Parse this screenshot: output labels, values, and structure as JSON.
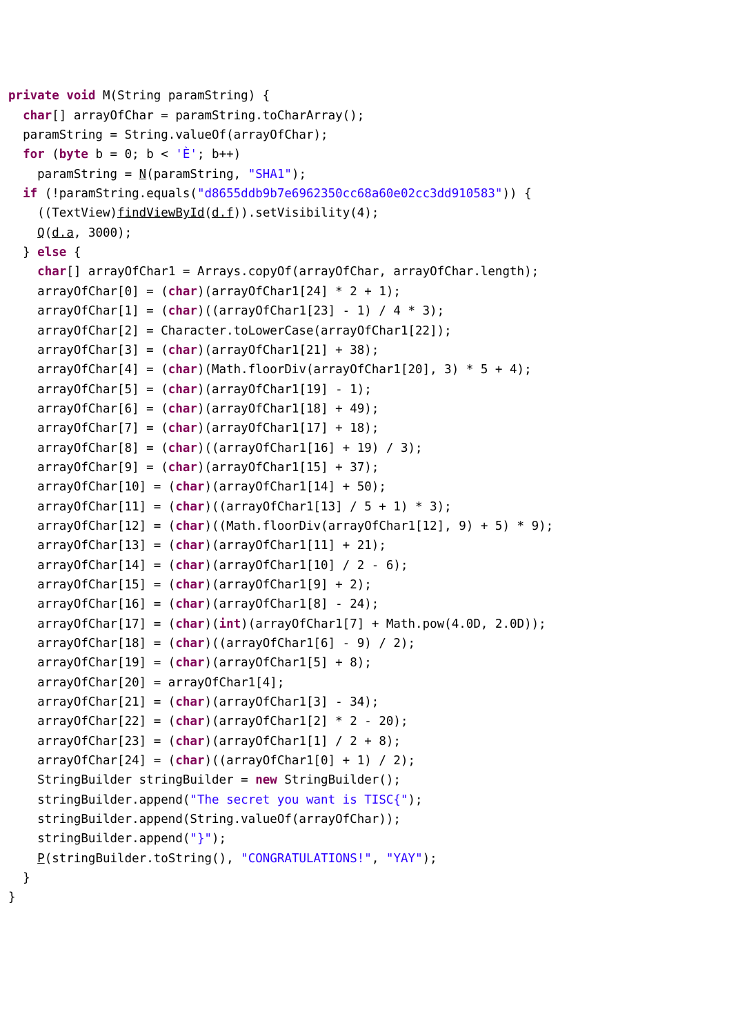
{
  "kw": {
    "private": "private",
    "void": "void",
    "char": "char",
    "for": "for",
    "byte": "byte",
    "if": "if",
    "else": "else",
    "int": "int",
    "new": "new"
  },
  "id": {
    "M": "M",
    "N": "N",
    "Q": "Q",
    "P": "P",
    "findViewById": "findViewById",
    "dDotF": "d",
    "dDotA": "d",
    "f": "f",
    "a": "a"
  },
  "txt": {
    "sig": " M(String paramString) {",
    "l2a": "[] arrayOfChar = paramString.toCharArray();",
    "l3": "  paramString = String.valueOf(arrayOfChar);",
    "l4a": " (",
    "l4b": " b = 0; b < ",
    "l4c": "; b++)",
    "l5a": "    paramString = ",
    "l5b": "(paramString, ",
    "l5c": ");",
    "l6a": " (!paramString.equals(",
    "l6b": ")) {",
    "l7a": "    ((TextView)",
    "l7b": "(",
    "l7c": ")).setVisibility(4);",
    "l8a": "(",
    "l8b": ", 3000);",
    "l9a": "  } ",
    "l9b": " {",
    "l10a": "[] arrayOfChar1 = Arrays.copyOf(arrayOfChar, arrayOfChar.length);",
    "l11": "    arrayOfChar[0] = (",
    "l11b": ")(arrayOfChar1[24] * 2 + 1);",
    "l12": "    arrayOfChar[1] = (",
    "l12b": ")((arrayOfChar1[23] - 1) / 4 * 3);",
    "l13": "    arrayOfChar[2] = Character.toLowerCase(arrayOfChar1[22]);",
    "l14": "    arrayOfChar[3] = (",
    "l14b": ")(arrayOfChar1[21] + 38);",
    "l15": "    arrayOfChar[4] = (",
    "l15b": ")(Math.floorDiv(arrayOfChar1[20], 3) * 5 + 4);",
    "l16": "    arrayOfChar[5] = (",
    "l16b": ")(arrayOfChar1[19] - 1);",
    "l17": "    arrayOfChar[6] = (",
    "l17b": ")(arrayOfChar1[18] + 49);",
    "l18": "    arrayOfChar[7] = (",
    "l18b": ")(arrayOfChar1[17] + 18);",
    "l19": "    arrayOfChar[8] = (",
    "l19b": ")((arrayOfChar1[16] + 19) / 3);",
    "l20": "    arrayOfChar[9] = (",
    "l20b": ")(arrayOfChar1[15] + 37);",
    "l21": "    arrayOfChar[10] = (",
    "l21b": ")(arrayOfChar1[14] + 50);",
    "l22": "    arrayOfChar[11] = (",
    "l22b": ")((arrayOfChar1[13] / 5 + 1) * 3);",
    "l23": "    arrayOfChar[12] = (",
    "l23b": ")((Math.floorDiv(arrayOfChar1[12], 9) + 5) * 9);",
    "l24": "    arrayOfChar[13] = (",
    "l24b": ")(arrayOfChar1[11] + 21);",
    "l25": "    arrayOfChar[14] = (",
    "l25b": ")(arrayOfChar1[10] / 2 - 6);",
    "l26": "    arrayOfChar[15] = (",
    "l26b": ")(arrayOfChar1[9] + 2);",
    "l27": "    arrayOfChar[16] = (",
    "l27b": ")(arrayOfChar1[8] - 24);",
    "l28": "    arrayOfChar[17] = (",
    "l28b": ")(",
    "l28c": ")(arrayOfChar1[7] + Math.pow(4.0D, 2.0D));",
    "l29": "    arrayOfChar[18] = (",
    "l29b": ")((arrayOfChar1[6] - 9) / 2);",
    "l30": "    arrayOfChar[19] = (",
    "l30b": ")(arrayOfChar1[5] + 8);",
    "l31": "    arrayOfChar[20] = arrayOfChar1[4];",
    "l32": "    arrayOfChar[21] = (",
    "l32b": ")(arrayOfChar1[3] - 34);",
    "l33": "    arrayOfChar[22] = (",
    "l33b": ")(arrayOfChar1[2] * 2 - 20);",
    "l34": "    arrayOfChar[23] = (",
    "l34b": ")(arrayOfChar1[1] / 2 + 8);",
    "l35": "    arrayOfChar[24] = (",
    "l35b": ")((arrayOfChar1[0] + 1) / 2);",
    "l36a": "    StringBuilder stringBuilder = ",
    "l36b": " StringBuilder();",
    "l37a": "    stringBuilder.append(",
    "l37b": ");",
    "l38": "    stringBuilder.append(String.valueOf(arrayOfChar));",
    "l39a": "    stringBuilder.append(",
    "l39b": ");",
    "l40a": "(stringBuilder.toString(), ",
    "l40b": ", ",
    "l40c": ");",
    "l41": "  }",
    "l42": "}",
    "dotF": ".",
    "dotA": "."
  },
  "str": {
    "eChar": "'È'",
    "sha1": "\"SHA1\"",
    "hash": "\"d8655ddb9b7e6962350cc68a60e02cc3dd910583\"",
    "secret": "\"The secret you want is TISC{\"",
    "brace": "\"}\"",
    "congrats": "\"CONGRATULATIONS!\"",
    "yay": "\"YAY\""
  }
}
